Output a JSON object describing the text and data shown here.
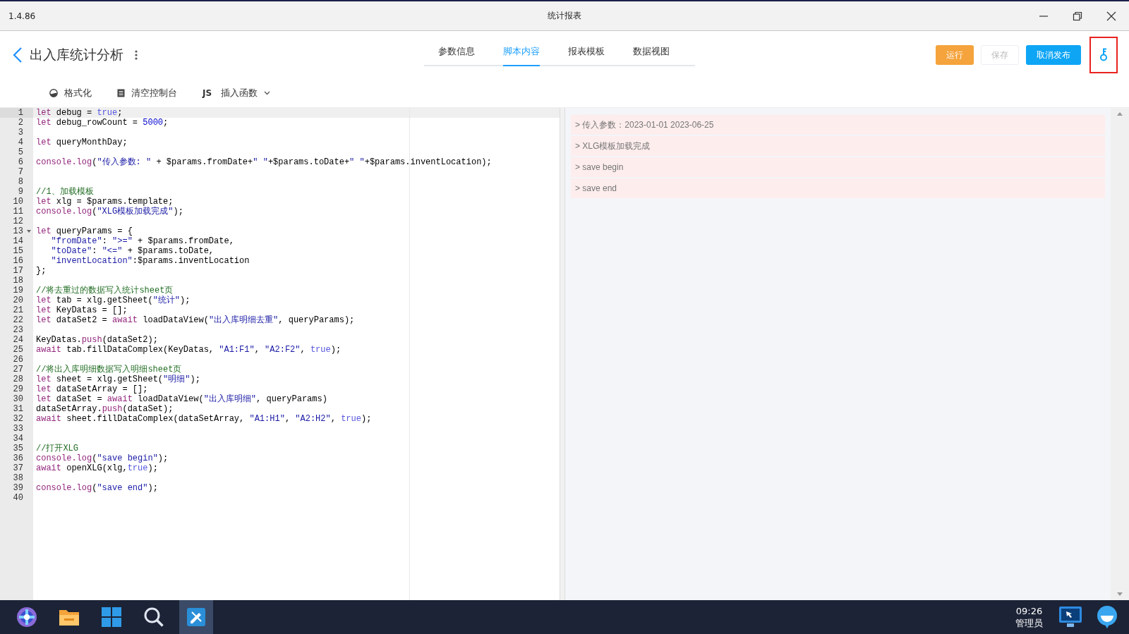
{
  "window": {
    "version": "1.4.86",
    "title": "统计报表"
  },
  "header": {
    "title": "出入库统计分析",
    "tabs": [
      {
        "label": "参数信息",
        "selected": false
      },
      {
        "label": "脚本内容",
        "selected": true
      },
      {
        "label": "报表模板",
        "selected": false
      },
      {
        "label": "数据视图",
        "selected": false
      }
    ],
    "buttons": [
      {
        "label": "运行",
        "kind": "warning",
        "disabled": false
      },
      {
        "label": "保存",
        "kind": "plain",
        "disabled": true
      },
      {
        "label": "取消发布",
        "kind": "primary",
        "disabled": false
      }
    ],
    "key_button": {
      "highlighted": true
    }
  },
  "toolbar": [
    {
      "kind": "format",
      "label": "格式化"
    },
    {
      "kind": "clear",
      "label": "清空控制台"
    },
    {
      "kind": "insert",
      "icon_text": "JS",
      "label": "插入函数",
      "dropdown": true
    }
  ],
  "editor": {
    "lines": [
      {
        "number": "1",
        "active": true,
        "fold": false,
        "tokens": [
          {
            "kind": "kw",
            "text": "let"
          },
          {
            "kind": "plain",
            "text": " debug = "
          },
          {
            "kind": "const",
            "text": "true"
          },
          {
            "kind": "plain",
            "text": ";"
          }
        ]
      },
      {
        "number": "2",
        "active": false,
        "fold": false,
        "tokens": [
          {
            "kind": "kw",
            "text": "let"
          },
          {
            "kind": "plain",
            "text": " debug_rowCount = "
          },
          {
            "kind": "num",
            "text": "5000"
          },
          {
            "kind": "plain",
            "text": ";"
          }
        ]
      },
      {
        "number": "3",
        "active": false,
        "fold": false
      },
      {
        "number": "4",
        "active": false,
        "fold": false,
        "tokens": [
          {
            "kind": "kw",
            "text": "let"
          },
          {
            "kind": "plain",
            "text": " queryMonthDay;"
          }
        ]
      },
      {
        "number": "5",
        "active": false,
        "fold": false
      },
      {
        "number": "6",
        "active": false,
        "fold": false,
        "tokens": [
          {
            "kind": "kw",
            "text": "console.log"
          },
          {
            "kind": "plain",
            "text": "("
          },
          {
            "kind": "str",
            "text": "\"传入参数: \""
          },
          {
            "kind": "plain",
            "text": " + $params.fromDate+"
          },
          {
            "kind": "str",
            "text": "\" \""
          },
          {
            "kind": "plain",
            "text": "+$params.toDate+"
          },
          {
            "kind": "str",
            "text": "\" \""
          },
          {
            "kind": "plain",
            "text": "+$params.inventLocation);"
          }
        ]
      },
      {
        "number": "7",
        "active": false,
        "fold": false
      },
      {
        "number": "8",
        "active": false,
        "fold": false
      },
      {
        "number": "9",
        "active": false,
        "fold": false,
        "tokens": [
          {
            "kind": "comment",
            "text": "//1、加载模板"
          }
        ]
      },
      {
        "number": "10",
        "active": false,
        "fold": false,
        "tokens": [
          {
            "kind": "kw",
            "text": "let"
          },
          {
            "kind": "plain",
            "text": " xlg = $params.template;"
          }
        ]
      },
      {
        "number": "11",
        "active": false,
        "fold": false,
        "tokens": [
          {
            "kind": "kw",
            "text": "console.log"
          },
          {
            "kind": "plain",
            "text": "("
          },
          {
            "kind": "str",
            "text": "\"XLG模板加载完成\""
          },
          {
            "kind": "plain",
            "text": ");"
          }
        ]
      },
      {
        "number": "12",
        "active": false,
        "fold": false
      },
      {
        "number": "13",
        "active": false,
        "fold": true,
        "tokens": [
          {
            "kind": "kw",
            "text": "let"
          },
          {
            "kind": "plain",
            "text": " queryParams = {"
          }
        ]
      },
      {
        "number": "14",
        "active": false,
        "fold": false,
        "tokens": [
          {
            "kind": "str",
            "text": "   \"fromDate\""
          },
          {
            "kind": "plain",
            "text": ": "
          },
          {
            "kind": "str",
            "text": "\">=\""
          },
          {
            "kind": "plain",
            "text": " + $params.fromDate,"
          }
        ]
      },
      {
        "number": "15",
        "active": false,
        "fold": false,
        "tokens": [
          {
            "kind": "str",
            "text": "   \"toDate\""
          },
          {
            "kind": "plain",
            "text": ": "
          },
          {
            "kind": "str",
            "text": "\"<=\""
          },
          {
            "kind": "plain",
            "text": " + $params.toDate,"
          }
        ]
      },
      {
        "number": "16",
        "active": false,
        "fold": false,
        "tokens": [
          {
            "kind": "str",
            "text": "   \"inventLocation\""
          },
          {
            "kind": "plain",
            "text": ":$params.inventLocation"
          }
        ]
      },
      {
        "number": "17",
        "active": false,
        "fold": false,
        "tokens": [
          {
            "kind": "plain",
            "text": "};"
          }
        ]
      },
      {
        "number": "18",
        "active": false,
        "fold": false
      },
      {
        "number": "19",
        "active": false,
        "fold": false,
        "tokens": [
          {
            "kind": "comment",
            "text": "//将去重过的数据写入统计sheet页"
          }
        ]
      },
      {
        "number": "20",
        "active": false,
        "fold": false,
        "tokens": [
          {
            "kind": "kw",
            "text": "let"
          },
          {
            "kind": "plain",
            "text": " tab = xlg.getSheet("
          },
          {
            "kind": "str",
            "text": "\"统计\""
          },
          {
            "kind": "plain",
            "text": ");"
          }
        ]
      },
      {
        "number": "21",
        "active": false,
        "fold": false,
        "tokens": [
          {
            "kind": "kw",
            "text": "let"
          },
          {
            "kind": "plain",
            "text": " KeyDatas = [];"
          }
        ]
      },
      {
        "number": "22",
        "active": false,
        "fold": false,
        "tokens": [
          {
            "kind": "kw",
            "text": "let"
          },
          {
            "kind": "plain",
            "text": " dataSet2 = "
          },
          {
            "kind": "kw",
            "text": "await"
          },
          {
            "kind": "plain",
            "text": " loadDataView("
          },
          {
            "kind": "str",
            "text": "\"出入库明细去重\""
          },
          {
            "kind": "plain",
            "text": ", queryParams);"
          }
        ]
      },
      {
        "number": "23",
        "active": false,
        "fold": false
      },
      {
        "number": "24",
        "active": false,
        "fold": false,
        "tokens": [
          {
            "kind": "plain",
            "text": "KeyDatas."
          },
          {
            "kind": "kw",
            "text": "push"
          },
          {
            "kind": "plain",
            "text": "(dataSet2);"
          }
        ]
      },
      {
        "number": "25",
        "active": false,
        "fold": false,
        "tokens": [
          {
            "kind": "kw",
            "text": "await"
          },
          {
            "kind": "plain",
            "text": " tab.fillDataComplex(KeyDatas, "
          },
          {
            "kind": "str",
            "text": "\"A1:F1\""
          },
          {
            "kind": "plain",
            "text": ", "
          },
          {
            "kind": "str",
            "text": "\"A2:F2\""
          },
          {
            "kind": "plain",
            "text": ", "
          },
          {
            "kind": "const",
            "text": "true"
          },
          {
            "kind": "plain",
            "text": ");"
          }
        ]
      },
      {
        "number": "26",
        "active": false,
        "fold": false
      },
      {
        "number": "27",
        "active": false,
        "fold": false,
        "tokens": [
          {
            "kind": "comment",
            "text": "//将出入库明细数据写入明细sheet页"
          }
        ]
      },
      {
        "number": "28",
        "active": false,
        "fold": false,
        "tokens": [
          {
            "kind": "kw",
            "text": "let"
          },
          {
            "kind": "plain",
            "text": " sheet = xlg.getSheet("
          },
          {
            "kind": "str",
            "text": "\"明细\""
          },
          {
            "kind": "plain",
            "text": ");"
          }
        ]
      },
      {
        "number": "29",
        "active": false,
        "fold": false,
        "tokens": [
          {
            "kind": "kw",
            "text": "let"
          },
          {
            "kind": "plain",
            "text": " dataSetArray = [];"
          }
        ]
      },
      {
        "number": "30",
        "active": false,
        "fold": false,
        "tokens": [
          {
            "kind": "kw",
            "text": "let"
          },
          {
            "kind": "plain",
            "text": " dataSet = "
          },
          {
            "kind": "kw",
            "text": "await"
          },
          {
            "kind": "plain",
            "text": " loadDataView("
          },
          {
            "kind": "str",
            "text": "\"出入库明细\""
          },
          {
            "kind": "plain",
            "text": ", queryParams)"
          }
        ]
      },
      {
        "number": "31",
        "active": false,
        "fold": false,
        "tokens": [
          {
            "kind": "plain",
            "text": "dataSetArray."
          },
          {
            "kind": "kw",
            "text": "push"
          },
          {
            "kind": "plain",
            "text": "(dataSet);"
          }
        ]
      },
      {
        "number": "32",
        "active": false,
        "fold": false,
        "tokens": [
          {
            "kind": "kw",
            "text": "await"
          },
          {
            "kind": "plain",
            "text": " sheet.fillDataComplex(dataSetArray, "
          },
          {
            "kind": "str",
            "text": "\"A1:H1\""
          },
          {
            "kind": "plain",
            "text": ", "
          },
          {
            "kind": "str",
            "text": "\"A2:H2\""
          },
          {
            "kind": "plain",
            "text": ", "
          },
          {
            "kind": "const",
            "text": "true"
          },
          {
            "kind": "plain",
            "text": ");"
          }
        ]
      },
      {
        "number": "33",
        "active": false,
        "fold": false
      },
      {
        "number": "34",
        "active": false,
        "fold": false
      },
      {
        "number": "35",
        "active": false,
        "fold": false,
        "tokens": [
          {
            "kind": "comment",
            "text": "//打开XLG"
          }
        ]
      },
      {
        "number": "36",
        "active": false,
        "fold": false,
        "tokens": [
          {
            "kind": "kw",
            "text": "console.log"
          },
          {
            "kind": "plain",
            "text": "("
          },
          {
            "kind": "str",
            "text": "\"save begin\""
          },
          {
            "kind": "plain",
            "text": ");"
          }
        ]
      },
      {
        "number": "37",
        "active": false,
        "fold": false,
        "tokens": [
          {
            "kind": "kw",
            "text": "await"
          },
          {
            "kind": "plain",
            "text": " openXLG(xlg,"
          },
          {
            "kind": "const",
            "text": "true"
          },
          {
            "kind": "plain",
            "text": ");"
          }
        ]
      },
      {
        "number": "38",
        "active": false,
        "fold": false
      },
      {
        "number": "39",
        "active": false,
        "fold": false,
        "tokens": [
          {
            "kind": "kw",
            "text": "console.log"
          },
          {
            "kind": "plain",
            "text": "("
          },
          {
            "kind": "str",
            "text": "\"save end\""
          },
          {
            "kind": "plain",
            "text": ");"
          }
        ]
      },
      {
        "number": "40",
        "active": false,
        "fold": false
      }
    ]
  },
  "console": {
    "entries": [
      "> 传入参数：2023-01-01 2023-06-25",
      "> XLG模板加载完成",
      "> save begin",
      "> save end"
    ]
  },
  "taskbar": {
    "apps": [
      {
        "kind": "launcher",
        "active": false
      },
      {
        "kind": "files",
        "active": false
      },
      {
        "kind": "start",
        "active": false
      },
      {
        "kind": "search",
        "active": false
      },
      {
        "kind": "designer",
        "active": true
      }
    ],
    "time": "09:26",
    "user": "管理员",
    "tray": [
      {
        "kind": "screen"
      },
      {
        "kind": "chat"
      }
    ]
  }
}
